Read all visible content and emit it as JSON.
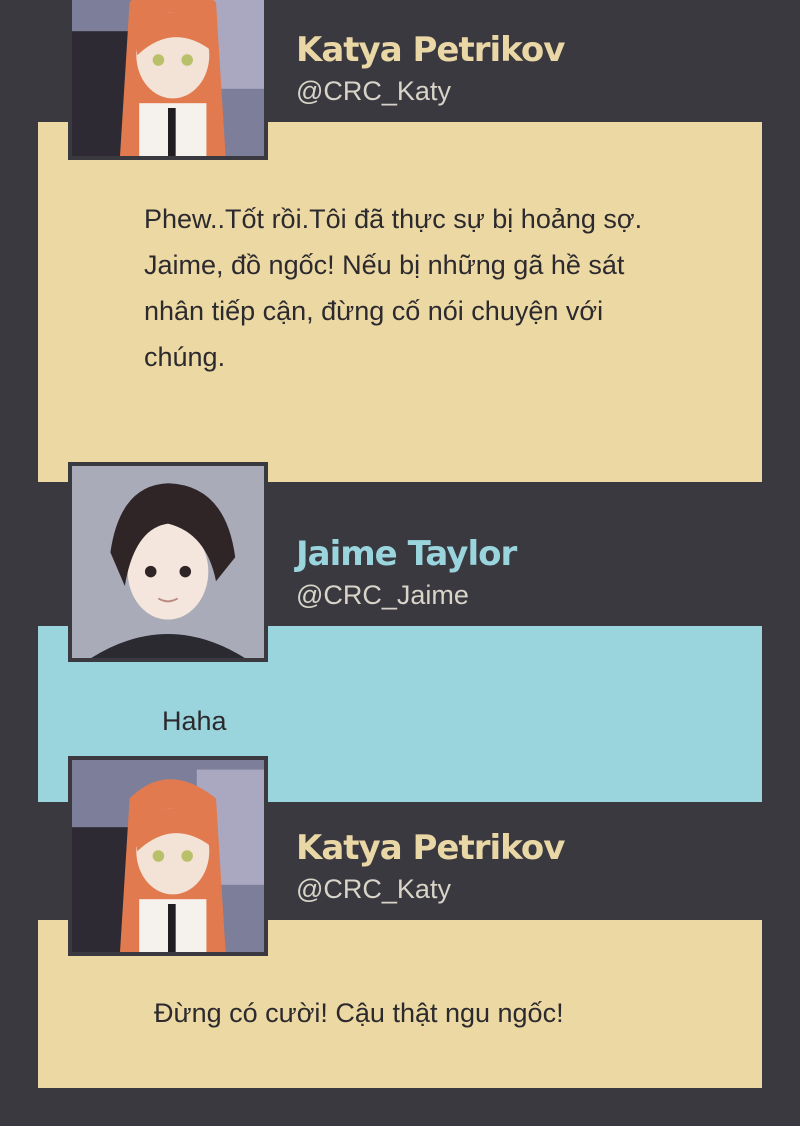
{
  "colors": {
    "background": "#3a3940",
    "katya_panel": "#ebd8a3",
    "jaime_panel": "#9ad5dd",
    "katya_name": "#ead7a6",
    "jaime_name": "#9ad5de",
    "handle": "#d8d4c8",
    "message_text": "#2c2a2e"
  },
  "messages": [
    {
      "author": "Katya Petrikov",
      "handle": "@CRC_Katy",
      "avatar": "katya-avatar",
      "text": "Phew..Tốt rồi.Tôi đã thực sự bị hoảng sợ.\nJaime, đồ ngốc! Nếu bị những gã hề sát\nnhân tiếp cận, đừng cố nói chuyện với\nchúng."
    },
    {
      "author": "Jaime Taylor",
      "handle": "@CRC_Jaime",
      "avatar": "jaime-avatar",
      "text": "Haha"
    },
    {
      "author": "Katya Petrikov",
      "handle": "@CRC_Katy",
      "avatar": "katya-avatar",
      "text": "Đừng có cười! Cậu thật ngu ngốc!"
    }
  ]
}
